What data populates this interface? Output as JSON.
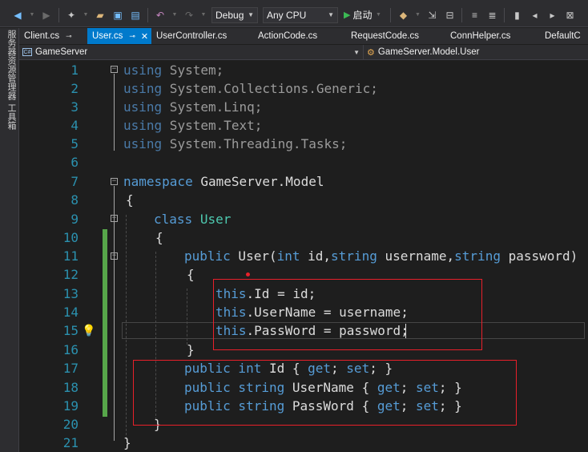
{
  "toolbar": {
    "config_select": "Debug",
    "platform_select": "Any CPU",
    "run_label": "启动"
  },
  "side_rail": {
    "items": [
      "服务器资源管理器",
      "工具箱"
    ]
  },
  "tabs": [
    {
      "label": "Client.cs",
      "active": false,
      "pinned": true
    },
    {
      "label": "User.cs",
      "active": true,
      "pinned": true
    },
    {
      "label": "UserController.cs",
      "active": false
    },
    {
      "label": "ActionCode.cs",
      "active": false
    },
    {
      "label": "RequestCode.cs",
      "active": false
    },
    {
      "label": "ConnHelper.cs",
      "active": false
    },
    {
      "label": "DefaultC",
      "active": false
    }
  ],
  "navbar": {
    "project": "GameServer",
    "type": "GameServer.Model.User"
  },
  "code": {
    "line_numbers": [
      "1",
      "2",
      "3",
      "4",
      "5",
      "6",
      "7",
      "8",
      "9",
      "10",
      "11",
      "12",
      "13",
      "14",
      "15",
      "16",
      "17",
      "18",
      "19",
      "20",
      "21"
    ],
    "l1_kw": "using",
    "l1_rest": " System;",
    "l2_kw": "using",
    "l2_rest": " System.Collections.Generic;",
    "l3_kw": "using",
    "l3_rest": " System.Linq;",
    "l4_kw": "using",
    "l4_rest": " System.Text;",
    "l5_kw": "using",
    "l5_rest": " System.Threading.Tasks;",
    "l7_kw": "namespace",
    "l7_rest": " GameServer.Model",
    "l8": "{",
    "l9_kw": "class",
    "l9_type": "User",
    "l10": "{",
    "l11_kw1": "public",
    "l11_a": " User(",
    "l11_kw2": "int",
    "l11_b": " id,",
    "l11_kw3": "string",
    "l11_c": " username,",
    "l11_kw4": "string",
    "l11_d": " password)",
    "l12": "{",
    "l13_kw": "this",
    "l13_rest": ".Id = id;",
    "l14_kw": "this",
    "l14_rest": ".UserName = username;",
    "l15_kw": "this",
    "l15_rest": ".PassWord = password;",
    "l16": "}",
    "l17_kw1": "public",
    "l17_kw2": " int",
    "l17_a": " Id { ",
    "l17_kw3": "get",
    "l17_b": "; ",
    "l17_kw4": "set",
    "l17_c": "; }",
    "l18_kw1": "public",
    "l18_kw2": " string",
    "l18_a": " UserName { ",
    "l18_kw3": "get",
    "l18_b": "; ",
    "l18_kw4": "set",
    "l18_c": "; }",
    "l19_kw1": "public",
    "l19_kw2": " string",
    "l19_a": " PassWord { ",
    "l19_kw3": "get",
    "l19_b": "; ",
    "l19_kw4": "set",
    "l19_c": "; }",
    "l20": "}",
    "l21": "}"
  },
  "colors": {
    "keyword": "#569cd6",
    "type": "#4ec9b0",
    "line_number": "#2b91af",
    "annotation": "#e8202a",
    "active_tab": "#007acc"
  }
}
